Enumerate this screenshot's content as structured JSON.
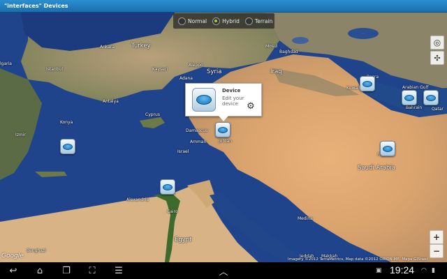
{
  "app": {
    "title": "\"interfaces\" Devices"
  },
  "map_type": {
    "options": [
      {
        "label": "Normal",
        "selected": false
      },
      {
        "label": "Hybrid",
        "selected": true
      },
      {
        "label": "Terrain",
        "selected": false
      }
    ]
  },
  "labels": {
    "turkey": "Turkey",
    "syria": "Syria",
    "iraq": "Iraq",
    "cyprus": "Cyprus",
    "israel": "Israel",
    "jordan": "Jordan",
    "egypt": "Egypt",
    "saudi_arabia": "Saudi Arabia",
    "kuwait": "Kuwait",
    "bahrain": "Bahrain",
    "qatar": "Qatar",
    "arabian_gulf": "Arabian Gulf",
    "ankara": "Ankara",
    "istanbul": "Istanbul",
    "izmir": "Izmir",
    "antalya": "Antalya",
    "aleppo": "Aleppo",
    "mosul": "Mosul",
    "baghdad": "Baghdad",
    "damascus": "Damascus",
    "amman": "Amman",
    "alexandria": "Alexandria",
    "cairo": "Cairo",
    "benghazi": "Benghazi",
    "riyadh": "Riyadh",
    "medina": "Medina",
    "makkah": "Makkah",
    "jeddah": "Jeddah",
    "basra": "Basra",
    "bulgaria": "lgaria",
    "kayseri": "Kayseri",
    "konya": "Konya",
    "adana": "Adana"
  },
  "info_window": {
    "title": "Device",
    "subtitle": "Edit your device",
    "icon": "device-icon",
    "action_icon": "gear-icon"
  },
  "controls": {
    "zoom_in": "+",
    "zoom_out": "−",
    "my_location_icon": "target-icon",
    "compass_icon": "compass-icon"
  },
  "attribution": {
    "logo": "Google",
    "copyright": "Imagery ©2012 TerraMetrics, Map data ©2012 ORION-ME, Mapa GISrael"
  },
  "system_bar": {
    "time": "19:24",
    "back_icon": "back-icon",
    "home_icon": "home-icon",
    "recent_icon": "recent-apps-icon",
    "screenshot_icon": "screenshot-icon",
    "menu_icon": "menu-icon",
    "up_icon": "chevron-up-icon"
  },
  "colors": {
    "titlebar": "#1b6fb0",
    "selected_radio": "#9ad33a"
  }
}
